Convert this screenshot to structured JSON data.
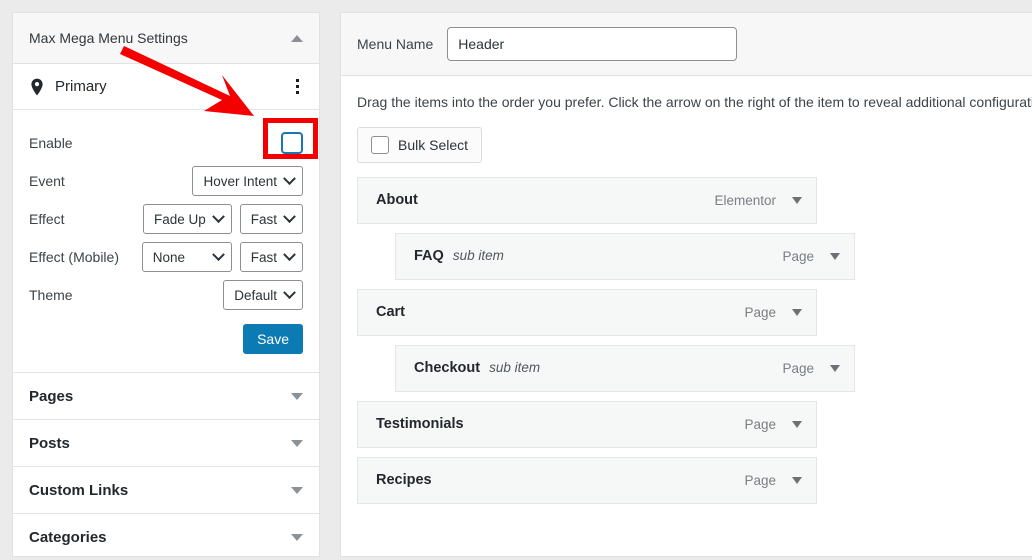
{
  "left_panel": {
    "header": {
      "title": "Max Mega Menu Settings",
      "collapse_icon": "triangle-up-icon"
    },
    "location": {
      "label": "Primary",
      "icon": "map-pin-icon",
      "menu_icon": "vertical-dots-icon"
    },
    "settings": {
      "enable": {
        "label": "Enable",
        "checked": false,
        "accent": "#1a76b8"
      },
      "event": {
        "label": "Event",
        "value": "Hover Intent"
      },
      "effect": {
        "label": "Effect",
        "value": "Fade Up",
        "speed": "Fast"
      },
      "effect_mobile": {
        "label": "Effect (Mobile)",
        "value": "None",
        "speed": "Fast"
      },
      "theme": {
        "label": "Theme",
        "value": "Default"
      },
      "save_label": "Save",
      "save_color": "#0d7bb3"
    },
    "accordions": [
      {
        "label": "Pages",
        "icon": "triangle-down-icon"
      },
      {
        "label": "Posts",
        "icon": "triangle-down-icon"
      },
      {
        "label": "Custom Links",
        "icon": "triangle-down-icon"
      },
      {
        "label": "Categories",
        "icon": "triangle-down-icon"
      }
    ]
  },
  "right_panel": {
    "menu_name_label": "Menu Name",
    "menu_name_value": "Header",
    "menu_name_placeholder": "Menu Name",
    "hint": "Drag the items into the order you prefer. Click the arrow on the right of the item to reveal additional configuration options.",
    "bulk_select_label": "Bulk Select",
    "bulk_select_checked": false,
    "menu_items": [
      {
        "title": "About",
        "sub_label": "",
        "type": "Elementor",
        "level": 0
      },
      {
        "title": "FAQ",
        "sub_label": "sub item",
        "type": "Page",
        "level": 1
      },
      {
        "title": "Cart",
        "sub_label": "",
        "type": "Page",
        "level": 0
      },
      {
        "title": "Checkout",
        "sub_label": "sub item",
        "type": "Page",
        "level": 1
      },
      {
        "title": "Testimonials",
        "sub_label": "",
        "type": "Page",
        "level": 0
      },
      {
        "title": "Recipes",
        "sub_label": "",
        "type": "Page",
        "level": 0
      }
    ]
  },
  "annotations": {
    "arrow_color": "#f40000",
    "highlight_color": "#f40000",
    "highlight_target": "enable-checkbox"
  }
}
